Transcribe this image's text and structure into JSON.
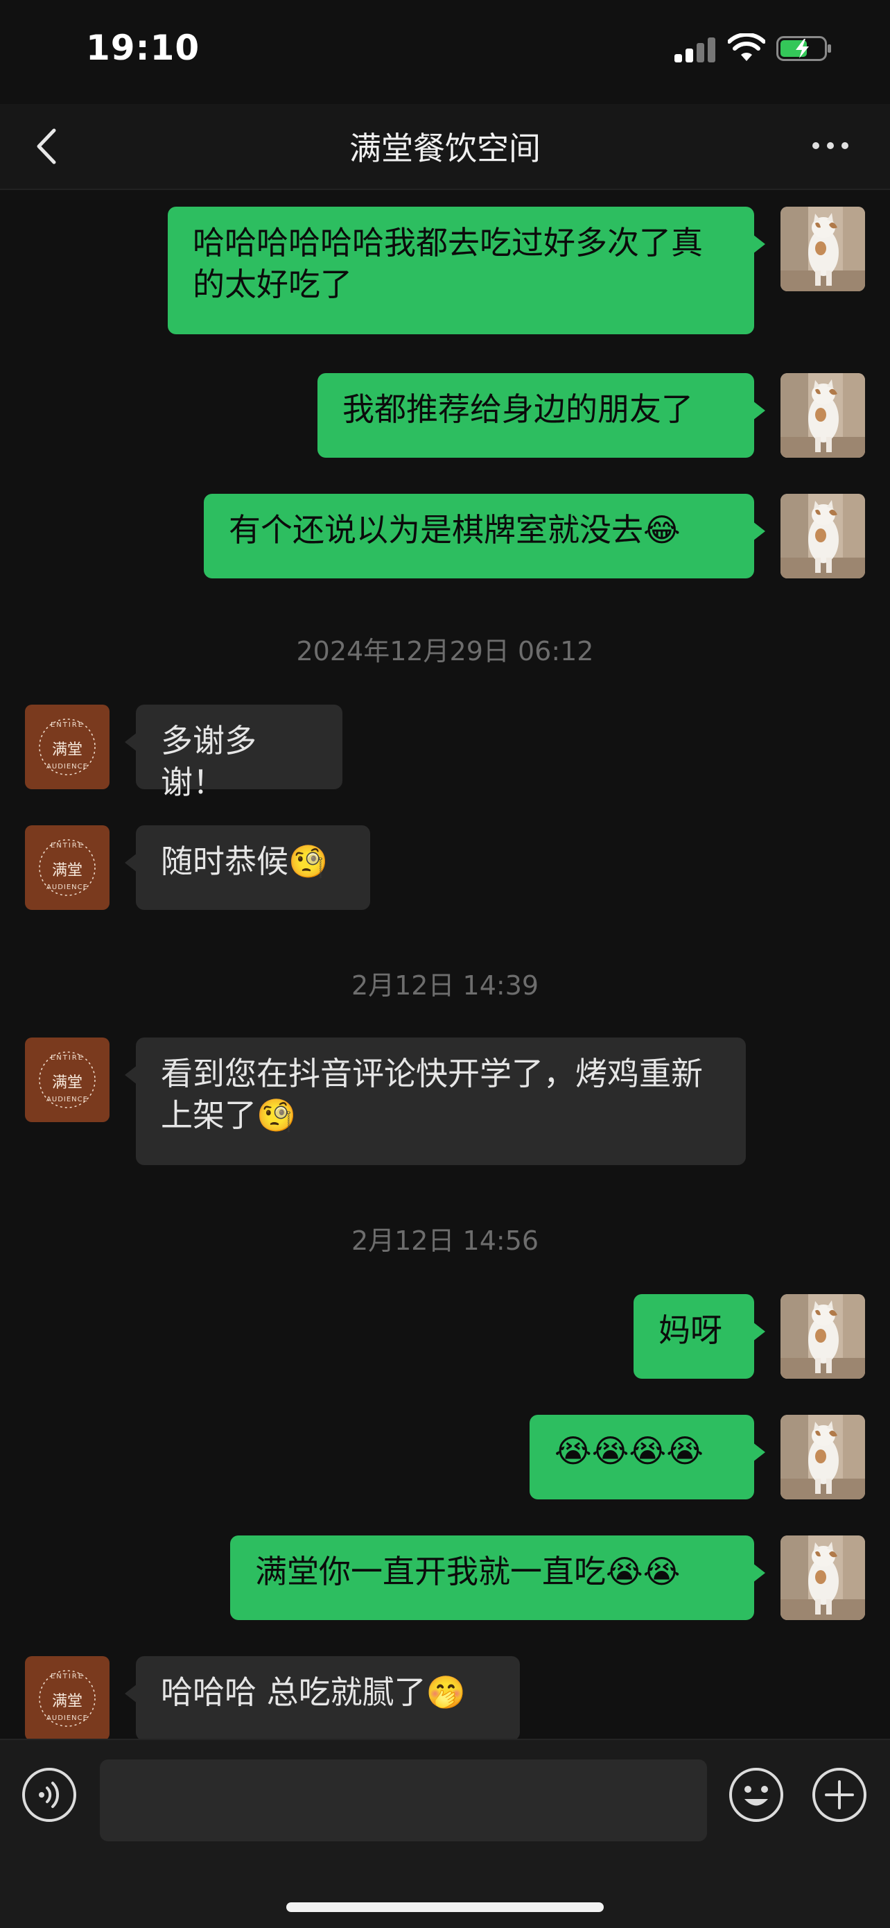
{
  "status_bar": {
    "time": "19:10"
  },
  "header": {
    "title": "满堂餐饮空间"
  },
  "messages": [
    {
      "from": "me",
      "text": "哈哈哈哈哈哈我都去吃过好多次了真的太好吃了"
    },
    {
      "from": "me",
      "text": "我都推荐给身边的朋友了"
    },
    {
      "from": "me",
      "text": "有个还说以为是棋牌室就没去😂"
    },
    {
      "type": "timestamp",
      "text": "2024年12月29日 06:12"
    },
    {
      "from": "them",
      "text": "多谢多谢！"
    },
    {
      "from": "them",
      "text": "随时恭候🧐"
    },
    {
      "type": "timestamp",
      "text": "2月12日 14:39"
    },
    {
      "from": "them",
      "text": "看到您在抖音评论快开学了，烤鸡重新上架了🧐"
    },
    {
      "type": "timestamp",
      "text": "2月12日 14:56"
    },
    {
      "from": "me",
      "text": "妈呀"
    },
    {
      "from": "me",
      "text": "😭😭😭😭"
    },
    {
      "from": "me",
      "text": "满堂你一直开我就一直吃😭😭"
    },
    {
      "from": "them",
      "text": "哈哈哈 总吃就腻了🤭"
    }
  ],
  "avatars": {
    "them_logo_top": "ENTIRE",
    "them_logo_mid": "满堂",
    "them_logo_bottom": "AUDIENCE"
  },
  "colors": {
    "my_bubble": "#2dbe60",
    "their_bubble": "#2b2b2b",
    "background": "#111111",
    "brand_avatar": "#7a3a1e"
  },
  "icons": [
    "back-chevron-icon",
    "more-dots-icon",
    "voice-icon",
    "emoji-icon",
    "plus-icon"
  ]
}
